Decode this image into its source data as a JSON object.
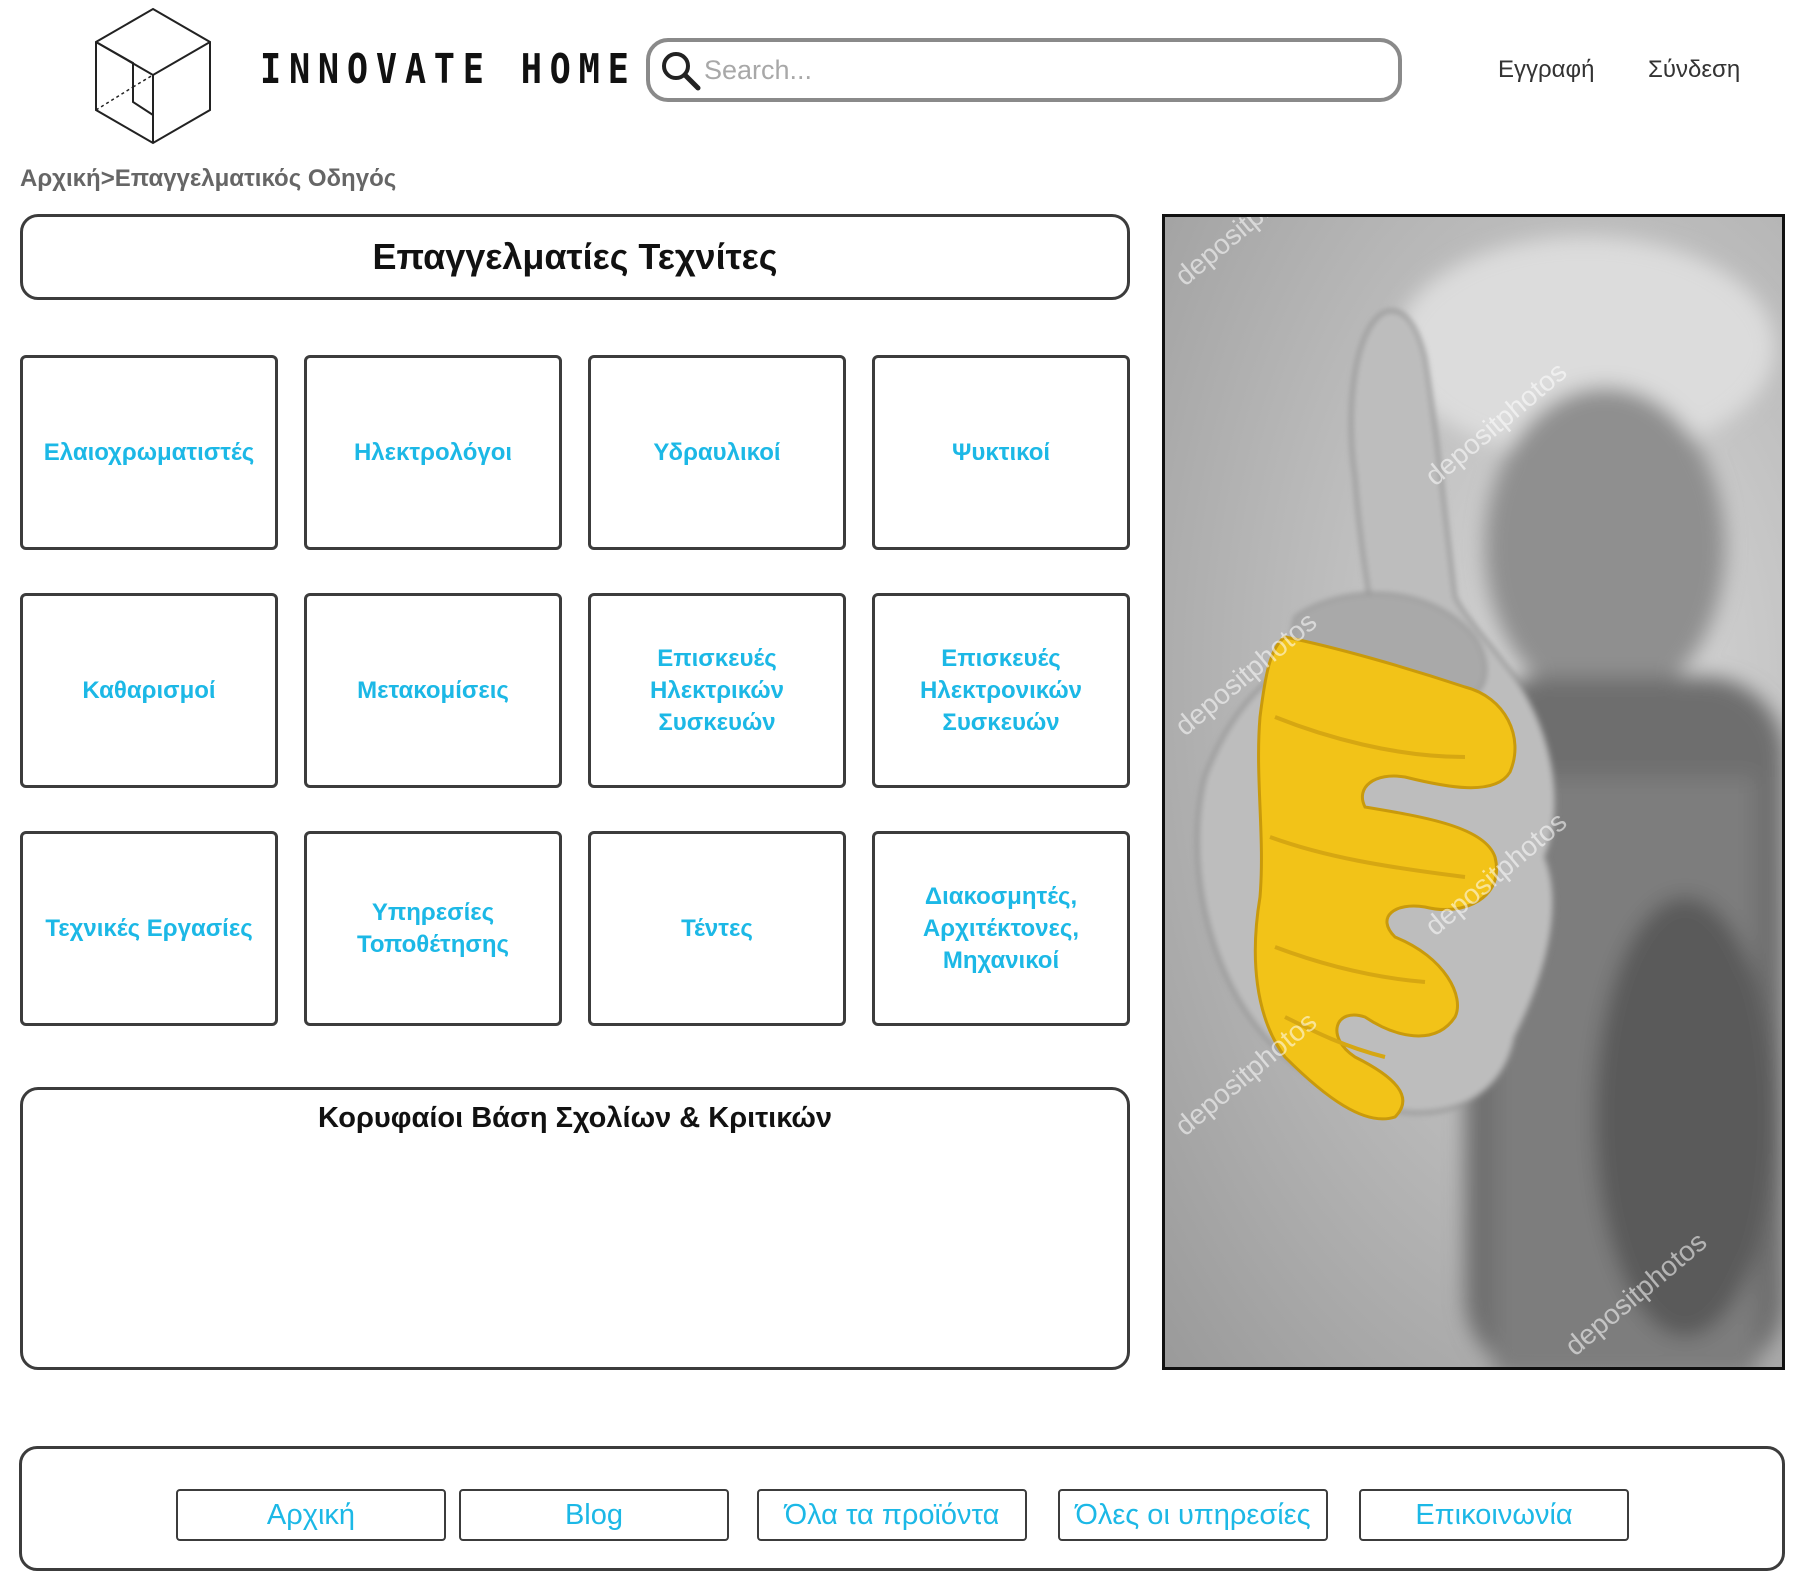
{
  "header": {
    "logo_text": "INNOVATE HOME",
    "search_placeholder": "Search...",
    "register_label": "Εγγραφή",
    "login_label": "Σύνδεση"
  },
  "breadcrumb": "Αρχική>Επαγγελματικός Οδηγός",
  "main": {
    "title": "Επαγγελματίες Τεχνίτες",
    "categories": [
      "Ελαιοχρωματιστές",
      "Ηλεκτρολόγοι",
      "Υδραυλικοί",
      "Ψυκτικοί",
      "Καθαρισμοί",
      "Μετακομίσεις",
      "Επισκευές\nΗλεκτρικών\nΣυσκευών",
      "Επισκευές\nΗλεκτρονικών\nΣυσκευών",
      "Τεχνικές Εργασίες",
      "Υπηρεσίες\nΤοποθέτησης",
      "Τέντες",
      "Διακοσμητές,\nΑρχιτέκτονες,\nΜηχανικοί"
    ],
    "reviews_title": "Κορυφαίοι Βάση Σχολίων & Κριτικών"
  },
  "hero": {
    "watermark": "depositphotos"
  },
  "footer": {
    "nav": [
      "Αρχική",
      "Blog",
      "Όλα τα προϊόντα",
      "Όλες οι υπηρεσίες",
      "Επικοινωνία"
    ]
  },
  "colors": {
    "accent": "#1cb8e6",
    "border": "#3c3c3c",
    "glove_yellow": "#f2c318"
  }
}
